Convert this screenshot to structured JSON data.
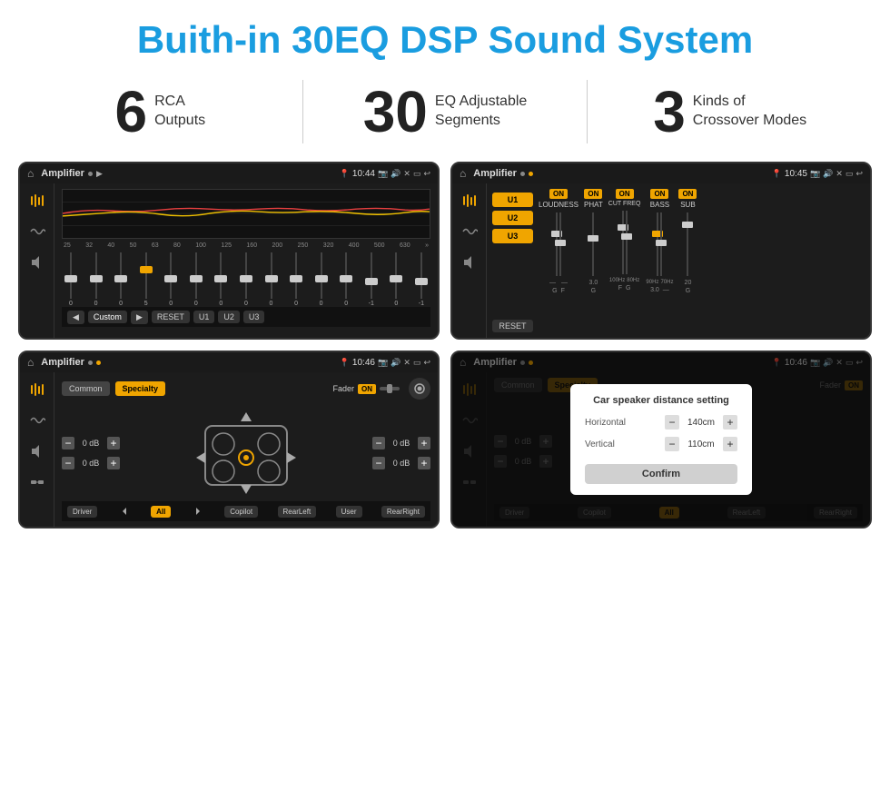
{
  "page": {
    "title": "Buith-in 30EQ DSP Sound System",
    "stats": [
      {
        "number": "6",
        "label": "RCA\nOutputs"
      },
      {
        "number": "30",
        "label": "EQ Adjustable\nSegments"
      },
      {
        "number": "3",
        "label": "Kinds of\nCrossover Modes"
      }
    ]
  },
  "screens": [
    {
      "id": "screen1",
      "status_bar": {
        "app": "Amplifier",
        "time": "10:44"
      },
      "type": "eq",
      "freq_labels": [
        "25",
        "32",
        "40",
        "50",
        "63",
        "80",
        "100",
        "125",
        "160",
        "200",
        "250",
        "320",
        "400",
        "500",
        "630"
      ],
      "slider_values": [
        "0",
        "0",
        "0",
        "5",
        "0",
        "0",
        "0",
        "0",
        "0",
        "0",
        "0",
        "0",
        "-1",
        "0",
        "-1"
      ],
      "bottom_buttons": [
        "◀",
        "Custom",
        "▶",
        "RESET",
        "U1",
        "U2",
        "U3"
      ]
    },
    {
      "id": "screen2",
      "status_bar": {
        "app": "Amplifier",
        "time": "10:45"
      },
      "type": "amp",
      "presets": [
        "U1",
        "U2",
        "U3"
      ],
      "controls": [
        {
          "label": "LOUDNESS",
          "on": true
        },
        {
          "label": "PHAT",
          "on": true
        },
        {
          "label": "CUT FREQ",
          "on": true
        },
        {
          "label": "BASS",
          "on": true
        },
        {
          "label": "SUB",
          "on": true
        }
      ],
      "reset_label": "RESET"
    },
    {
      "id": "screen3",
      "status_bar": {
        "app": "Amplifier",
        "time": "10:46"
      },
      "type": "crossover",
      "tabs": [
        "Common",
        "Specialty"
      ],
      "fader_label": "Fader",
      "fader_on": true,
      "db_values": [
        "0 dB",
        "0 dB",
        "0 dB",
        "0 dB"
      ],
      "bottom_buttons": [
        "Driver",
        "",
        "Copilot",
        "RearLeft",
        "All",
        "User",
        "RearRight"
      ]
    },
    {
      "id": "screen4",
      "status_bar": {
        "app": "Amplifier",
        "time": "10:46"
      },
      "type": "crossover_dialog",
      "tabs": [
        "Common",
        "Specialty"
      ],
      "fader_on": true,
      "dialog": {
        "title": "Car speaker distance setting",
        "horizontal_label": "Horizontal",
        "horizontal_value": "140cm",
        "vertical_label": "Vertical",
        "vertical_value": "110cm",
        "confirm_label": "Confirm"
      },
      "db_values": [
        "0 dB",
        "0 dB"
      ],
      "bottom_buttons": [
        "Driver",
        "Copilot",
        "RearLeft",
        "RearRight"
      ]
    }
  ],
  "icons": {
    "home": "⌂",
    "back": "↩",
    "music": "♪",
    "speaker": "◈",
    "volume": "♫",
    "eq_icon": "≡",
    "wave": "〜",
    "plus": "+",
    "minus": "−",
    "arrow_left": "◀",
    "arrow_right": "▶",
    "camera": "📷",
    "volume_icon": "🔊",
    "x_icon": "✕",
    "rect": "▭"
  }
}
